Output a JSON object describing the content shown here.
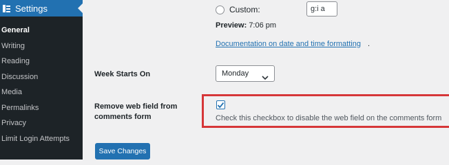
{
  "sidebar": {
    "header": {
      "icon": "settings-sliders-icon",
      "label": "Settings"
    },
    "items": [
      {
        "label": "General",
        "current": true
      },
      {
        "label": "Writing"
      },
      {
        "label": "Reading"
      },
      {
        "label": "Discussion"
      },
      {
        "label": "Media"
      },
      {
        "label": "Permalinks"
      },
      {
        "label": "Privacy"
      },
      {
        "label": "Limit Login Attempts"
      }
    ]
  },
  "time_format": {
    "custom_label": "Custom:",
    "custom_value": "g:i a",
    "preview_label": "Preview:",
    "preview_value": "7:06 pm",
    "doc_link": "Documentation on date and time formatting",
    "doc_period": "."
  },
  "week_starts": {
    "label": "Week Starts On",
    "selected": "Monday"
  },
  "web_field": {
    "label_line1": "Remove web field from",
    "label_line2": "comments form",
    "checked": true,
    "description": "Check this checkbox to disable the web field on the comments form"
  },
  "save_button": {
    "label": "Save Changes"
  },
  "colors": {
    "accent": "#2271b1",
    "sidebar_bg": "#1d2327",
    "highlight_border": "#d63638",
    "page_bg": "#f0f0f1"
  }
}
